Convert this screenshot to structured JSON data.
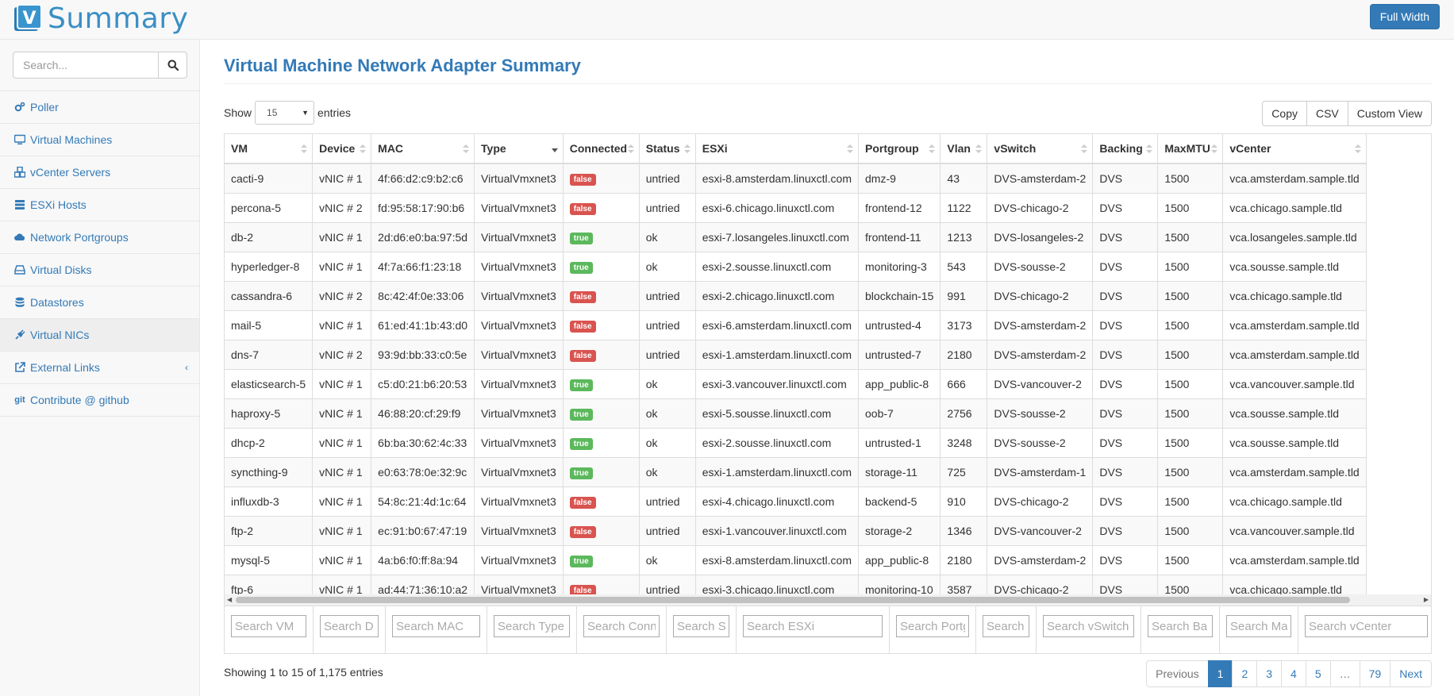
{
  "app": {
    "brand_letter": "V",
    "brand_name": "Summary",
    "fullwidth_label": "Full Width"
  },
  "sidebar": {
    "search_placeholder": "Search...",
    "items": [
      {
        "label": "Poller",
        "icon": "cogs-icon"
      },
      {
        "label": "Virtual Machines",
        "icon": "desktop-icon"
      },
      {
        "label": "vCenter Servers",
        "icon": "cubes-icon"
      },
      {
        "label": "ESXi Hosts",
        "icon": "server-icon"
      },
      {
        "label": "Network Portgroups",
        "icon": "cloud-icon"
      },
      {
        "label": "Virtual Disks",
        "icon": "hdd-icon"
      },
      {
        "label": "Datastores",
        "icon": "database-icon"
      },
      {
        "label": "Virtual NICs",
        "icon": "plug-icon",
        "active": true
      },
      {
        "label": "External Links",
        "icon": "external-link-icon"
      },
      {
        "label": "Contribute @ github",
        "icon": "git-icon"
      }
    ]
  },
  "main": {
    "title": "Virtual Machine Network Adapter Summary",
    "show_label": "Show",
    "entries_label": "entries",
    "page_length": "15",
    "buttons": [
      "Copy",
      "CSV",
      "Custom View"
    ],
    "columns": [
      "VM",
      "Device",
      "MAC",
      "Type",
      "Connected",
      "Status",
      "ESXi",
      "Portgroup",
      "Vlan",
      "vSwitch",
      "Backing",
      "MaxMTU",
      "vCenter"
    ],
    "filters": [
      "Search VM",
      "Search D",
      "Search MAC",
      "Search Type",
      "Search Conn",
      "Search S",
      "Search ESXi",
      "Search Portg",
      "Search",
      "Search vSwitch",
      "Search Ba",
      "Search Ma:",
      "Search vCenter"
    ],
    "rows": [
      [
        "cacti-9",
        "vNIC # 1",
        "4f:66:d2:c9:b2:c6",
        "VirtualVmxnet3",
        "false",
        "untried",
        "esxi-8.amsterdam.linuxctl.com",
        "dmz-9",
        "43",
        "DVS-amsterdam-2",
        "DVS",
        "1500",
        "vca.amsterdam.sample.tld"
      ],
      [
        "percona-5",
        "vNIC # 2",
        "fd:95:58:17:90:b6",
        "VirtualVmxnet3",
        "false",
        "untried",
        "esxi-6.chicago.linuxctl.com",
        "frontend-12",
        "1122",
        "DVS-chicago-2",
        "DVS",
        "1500",
        "vca.chicago.sample.tld"
      ],
      [
        "db-2",
        "vNIC # 1",
        "2d:d6:e0:ba:97:5d",
        "VirtualVmxnet3",
        "true",
        "ok",
        "esxi-7.losangeles.linuxctl.com",
        "frontend-11",
        "1213",
        "DVS-losangeles-2",
        "DVS",
        "1500",
        "vca.losangeles.sample.tld"
      ],
      [
        "hyperledger-8",
        "vNIC # 1",
        "4f:7a:66:f1:23:18",
        "VirtualVmxnet3",
        "true",
        "ok",
        "esxi-2.sousse.linuxctl.com",
        "monitoring-3",
        "543",
        "DVS-sousse-2",
        "DVS",
        "1500",
        "vca.sousse.sample.tld"
      ],
      [
        "cassandra-6",
        "vNIC # 2",
        "8c:42:4f:0e:33:06",
        "VirtualVmxnet3",
        "false",
        "untried",
        "esxi-2.chicago.linuxctl.com",
        "blockchain-15",
        "991",
        "DVS-chicago-2",
        "DVS",
        "1500",
        "vca.chicago.sample.tld"
      ],
      [
        "mail-5",
        "vNIC # 1",
        "61:ed:41:1b:43:d0",
        "VirtualVmxnet3",
        "false",
        "untried",
        "esxi-6.amsterdam.linuxctl.com",
        "untrusted-4",
        "3173",
        "DVS-amsterdam-2",
        "DVS",
        "1500",
        "vca.amsterdam.sample.tld"
      ],
      [
        "dns-7",
        "vNIC # 2",
        "93:9d:bb:33:c0:5e",
        "VirtualVmxnet3",
        "false",
        "untried",
        "esxi-1.amsterdam.linuxctl.com",
        "untrusted-7",
        "2180",
        "DVS-amsterdam-2",
        "DVS",
        "1500",
        "vca.amsterdam.sample.tld"
      ],
      [
        "elasticsearch-5",
        "vNIC # 1",
        "c5:d0:21:b6:20:53",
        "VirtualVmxnet3",
        "true",
        "ok",
        "esxi-3.vancouver.linuxctl.com",
        "app_public-8",
        "666",
        "DVS-vancouver-2",
        "DVS",
        "1500",
        "vca.vancouver.sample.tld"
      ],
      [
        "haproxy-5",
        "vNIC # 1",
        "46:88:20:cf:29:f9",
        "VirtualVmxnet3",
        "true",
        "ok",
        "esxi-5.sousse.linuxctl.com",
        "oob-7",
        "2756",
        "DVS-sousse-2",
        "DVS",
        "1500",
        "vca.sousse.sample.tld"
      ],
      [
        "dhcp-2",
        "vNIC # 1",
        "6b:ba:30:62:4c:33",
        "VirtualVmxnet3",
        "true",
        "ok",
        "esxi-2.sousse.linuxctl.com",
        "untrusted-1",
        "3248",
        "DVS-sousse-2",
        "DVS",
        "1500",
        "vca.sousse.sample.tld"
      ],
      [
        "syncthing-9",
        "vNIC # 1",
        "e0:63:78:0e:32:9c",
        "VirtualVmxnet3",
        "true",
        "ok",
        "esxi-1.amsterdam.linuxctl.com",
        "storage-11",
        "725",
        "DVS-amsterdam-1",
        "DVS",
        "1500",
        "vca.amsterdam.sample.tld"
      ],
      [
        "influxdb-3",
        "vNIC # 1",
        "54:8c:21:4d:1c:64",
        "VirtualVmxnet3",
        "false",
        "untried",
        "esxi-4.chicago.linuxctl.com",
        "backend-5",
        "910",
        "DVS-chicago-2",
        "DVS",
        "1500",
        "vca.chicago.sample.tld"
      ],
      [
        "ftp-2",
        "vNIC # 1",
        "ec:91:b0:67:47:19",
        "VirtualVmxnet3",
        "false",
        "untried",
        "esxi-1.vancouver.linuxctl.com",
        "storage-2",
        "1346",
        "DVS-vancouver-2",
        "DVS",
        "1500",
        "vca.vancouver.sample.tld"
      ],
      [
        "mysql-5",
        "vNIC # 1",
        "4a:b6:f0:ff:8a:94",
        "VirtualVmxnet3",
        "true",
        "ok",
        "esxi-8.amsterdam.linuxctl.com",
        "app_public-8",
        "2180",
        "DVS-amsterdam-2",
        "DVS",
        "1500",
        "vca.amsterdam.sample.tld"
      ],
      [
        "ftp-6",
        "vNIC # 1",
        "ad:44:71:36:10:a2",
        "VirtualVmxnet3",
        "false",
        "untried",
        "esxi-3.chicago.linuxctl.com",
        "monitoring-10",
        "3587",
        "DVS-chicago-2",
        "DVS",
        "1500",
        "vca.chicago.sample.tld"
      ]
    ],
    "info": "Showing 1 to 15 of 1,175 entries",
    "pagination": [
      "Previous",
      "1",
      "2",
      "3",
      "4",
      "5",
      "…",
      "79",
      "Next"
    ],
    "current_page": "1",
    "colors": {
      "primary": "#337ab7",
      "badge_false": "#d9534f",
      "badge_true": "#5cb85c"
    }
  }
}
